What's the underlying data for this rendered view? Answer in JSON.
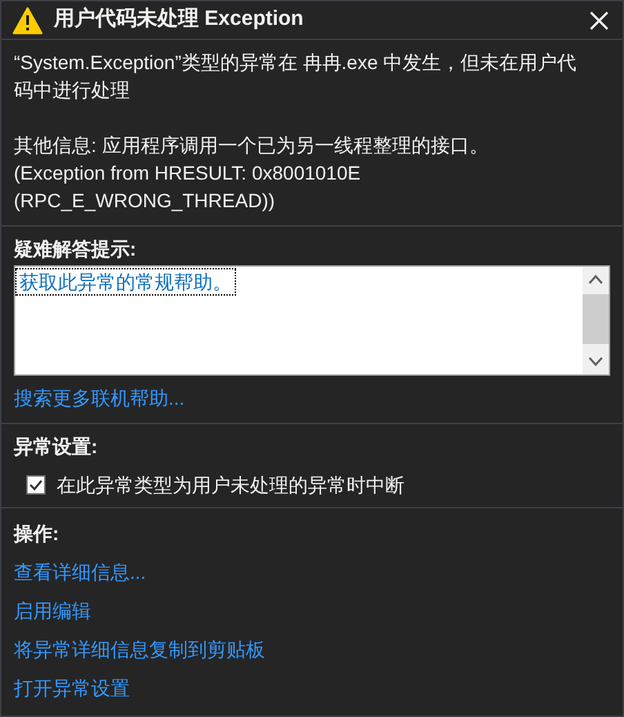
{
  "window": {
    "title": "用户代码未处理 Exception"
  },
  "message": "“System.Exception”类型的异常在 冉冉.exe 中发生，但未在用户代码中进行处理",
  "additional_info": [
    "其他信息: 应用程序调用一个已为另一线程整理的接口。",
    "(Exception from HRESULT: 0x8001010E",
    "(RPC_E_WRONG_THREAD))"
  ],
  "troubleshooting": {
    "heading": "疑难解答提示:",
    "items": [
      {
        "label": "获取此异常的常规帮助。",
        "selected": true
      }
    ],
    "link": "搜索更多联机帮助..."
  },
  "exception_settings": {
    "heading": "异常设置:",
    "checkbox": {
      "label": "在此异常类型为用户未处理的异常时中断",
      "checked": true
    }
  },
  "actions": {
    "heading": "操作:",
    "links": [
      "查看详细信息...",
      "启用编辑",
      "将异常详细信息复制到剪贴板",
      "打开异常设置"
    ]
  }
}
